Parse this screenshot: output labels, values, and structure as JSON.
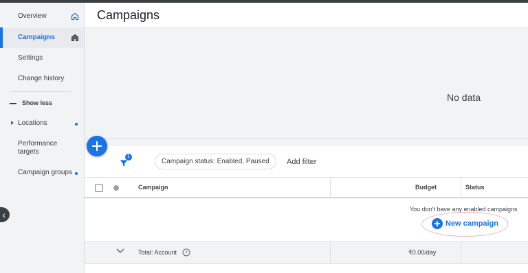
{
  "sidebar": {
    "items": [
      {
        "label": "Overview"
      },
      {
        "label": "Campaigns"
      },
      {
        "label": "Settings"
      },
      {
        "label": "Change history"
      },
      {
        "label": "Show less"
      },
      {
        "label": "Locations"
      },
      {
        "label": "Performance targets"
      },
      {
        "label": "Campaign groups"
      }
    ]
  },
  "header": {
    "title": "Campaigns"
  },
  "chart": {
    "empty_text": "No data"
  },
  "filters": {
    "badge_count": "1",
    "chip": "Campaign status: Enabled, Paused",
    "add_filter": "Add filter"
  },
  "table": {
    "columns": {
      "campaign": "Campaign",
      "budget": "Budget",
      "status": "Status"
    },
    "empty_message": "You don't have any enabled campaigns",
    "new_campaign": "New campaign",
    "total": {
      "label": "Total: Account",
      "budget": "₹0.00/day"
    }
  },
  "colors": {
    "accent": "#1a73e8",
    "sidebar_bg": "#f1f3f4",
    "annotation": "#f3b0b8"
  }
}
